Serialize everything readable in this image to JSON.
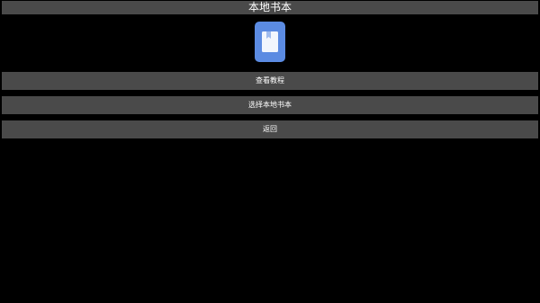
{
  "header": {
    "title": "本地书本"
  },
  "icon": {
    "name": "book-icon",
    "color": "#5b8be2"
  },
  "menu": {
    "view_tutorial": "查看教程",
    "select_local_book": "选择本地书本",
    "back": "返回"
  },
  "colors": {
    "background": "#000000",
    "bar": "#4a4a4a",
    "text": "#ffffff"
  }
}
